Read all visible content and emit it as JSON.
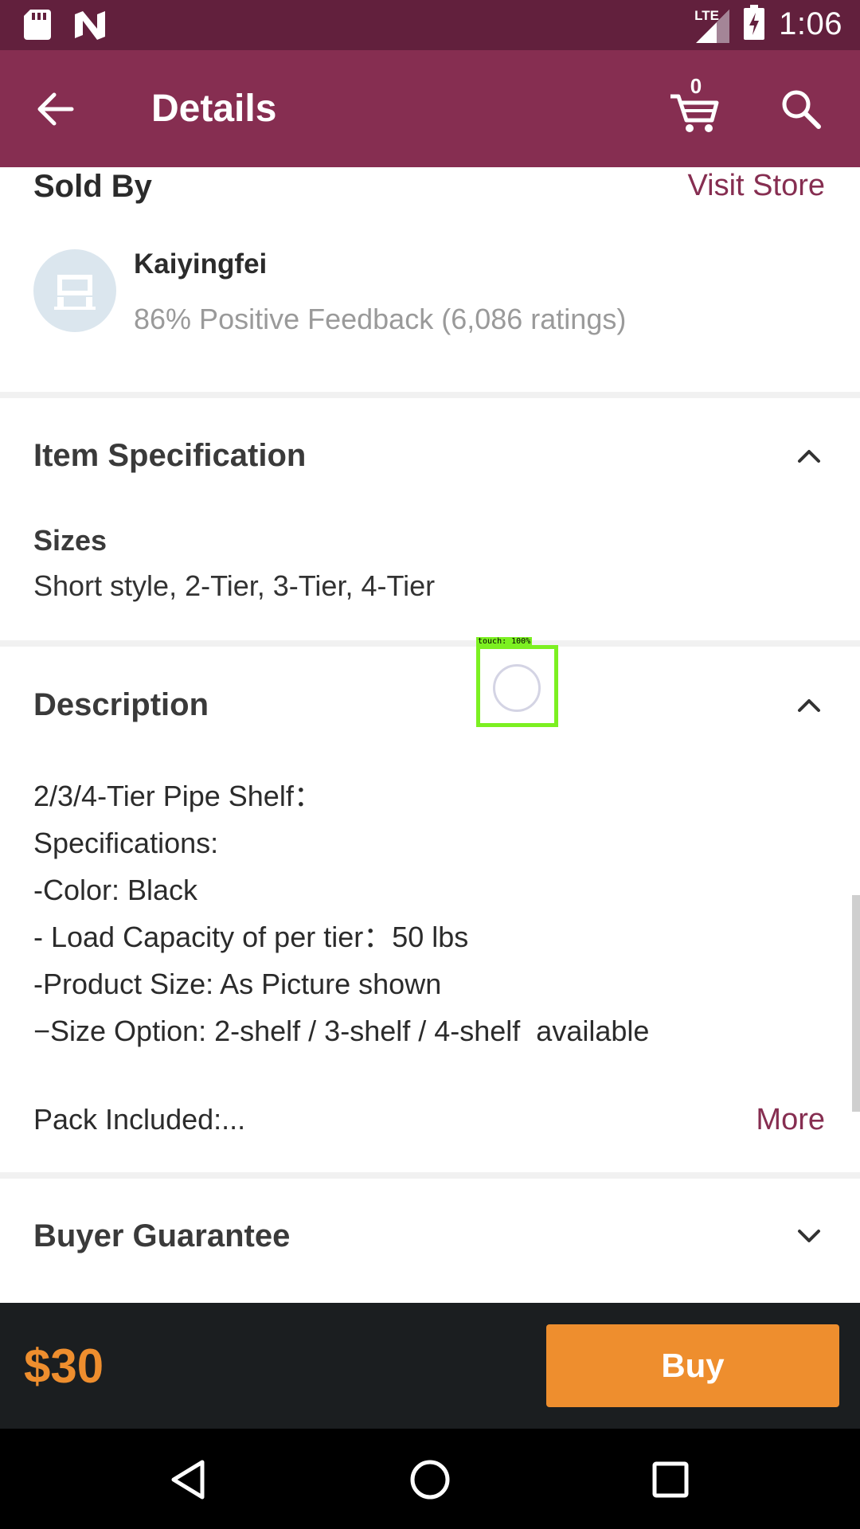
{
  "status_bar": {
    "time": "1:06",
    "network": "LTE",
    "icons": [
      "sd-card-icon",
      "n-notification-icon",
      "signal-icon",
      "battery-charging-icon"
    ]
  },
  "app_bar": {
    "title": "Details",
    "cart_count": "0",
    "icons": [
      "back-arrow-icon",
      "cart-icon",
      "search-icon"
    ]
  },
  "sold_by": {
    "title": "Sold By",
    "visit_store": "Visit Store",
    "store_name": "Kaiyingfei",
    "feedback": "86% Positive Feedback (6,086 ratings)"
  },
  "item_specification": {
    "title": "Item Specification",
    "label": "Sizes",
    "value": "Short style, 2-Tier, 3-Tier, 4-Tier"
  },
  "description": {
    "title": "Description",
    "lines": [
      "2/3/4-Tier Pipe Shelf：",
      "Specifications:",
      "-Color: Black",
      "- Load Capacity of per tier：50 lbs",
      "-Product Size: As Picture shown",
      "−Size Option: 2-shelf / 3-shelf / 4-shelf  available"
    ],
    "pack_included": "Pack Included:...",
    "more": "More"
  },
  "buyer_guarantee": {
    "title": "Buyer Guarantee"
  },
  "touch_overlay": {
    "label": "touch: 100%"
  },
  "bottom_bar": {
    "price": "$30",
    "buy_label": "Buy"
  },
  "colors": {
    "status_bar": "#62203d",
    "app_bar": "#862e51",
    "accent_link": "#862e51",
    "price": "#ee8e2e",
    "buy_button": "#ee8e2e",
    "bottom_bar": "#1b1e20"
  }
}
